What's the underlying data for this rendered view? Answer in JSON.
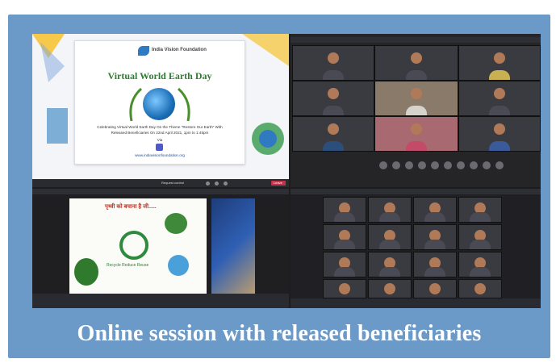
{
  "caption": "Online session with released beneficiaries",
  "slide": {
    "org_name": "India Vision Foundation",
    "title": "Virtual World Earth Day",
    "line1": "Celebrating Virtual World Earth Day On the Theme \"Restore Our Earth\" With",
    "line2": "Released Beneficiaries On 22nd April 2021, 1pm to 1:45pm",
    "via": "Via",
    "website": "www.indiavisionfoundation.org"
  },
  "meeting": {
    "leave_label": "Leave",
    "request_control": "Request control"
  },
  "poster": {
    "hindi_heading": "पृथ्वी को बचाना है जी.....",
    "recycle_words": "Recycle Reduce Reuse"
  },
  "colors": {
    "frame": "#6c9ac8",
    "caption": "#ffffff",
    "leave": "#c4314b",
    "slide_title": "#2e7d32"
  }
}
